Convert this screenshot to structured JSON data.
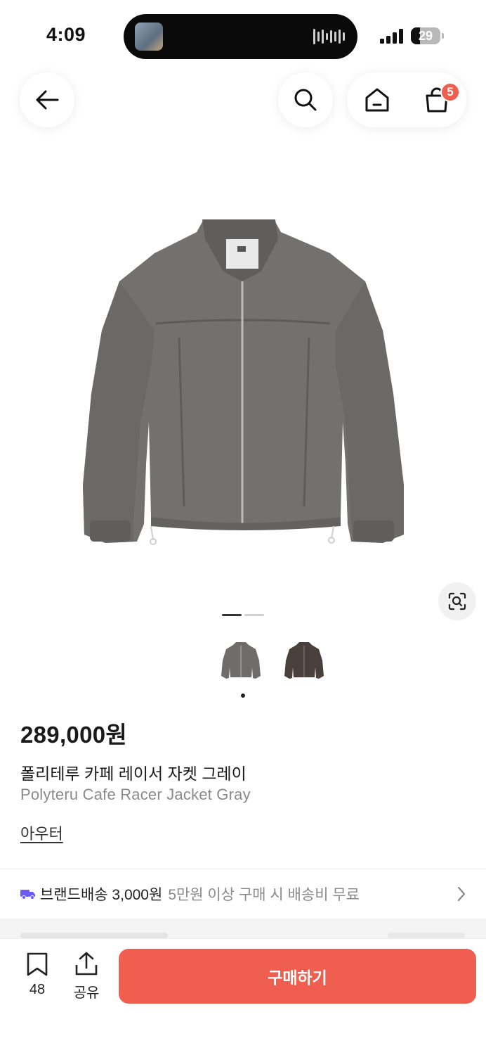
{
  "status_bar": {
    "time": "4:09",
    "battery_level": "29",
    "dynamic_island": {
      "activity": "audio-playing",
      "thumbnail_icon": "album-art-thumbnail"
    }
  },
  "nav": {
    "back_icon": "arrow-left-icon",
    "search_icon": "search-icon",
    "home_icon": "home-icon",
    "cart_icon": "shopping-bag-icon",
    "cart_count": "5"
  },
  "gallery": {
    "active_index": 0,
    "total_images": 2,
    "lens_icon": "image-search-lens-icon",
    "thumbnails": [
      {
        "color_name": "gray",
        "color_hex": "#6f6d6b"
      },
      {
        "color_name": "brown",
        "color_hex": "#4a403b"
      }
    ]
  },
  "product": {
    "price": "289,000원",
    "name_ko": "폴리테루 카페 레이서 자켓 그레이",
    "name_en": "Polyteru Cafe Racer Jacket Gray",
    "category": "아우터"
  },
  "shipping": {
    "icon": "delivery-truck-icon",
    "main": "브랜드배송 3,000원",
    "sub": "5만원 이상 구매 시 배송비 무료"
  },
  "bottom_bar": {
    "bookmark_icon": "bookmark-icon",
    "bookmark_count": "48",
    "share_icon": "share-icon",
    "share_label": "공유",
    "buy_label": "구매하기"
  },
  "colors": {
    "accent": "#ef5e4e",
    "truck": "#6b5cf6",
    "muted_text": "#8a8a8a"
  }
}
